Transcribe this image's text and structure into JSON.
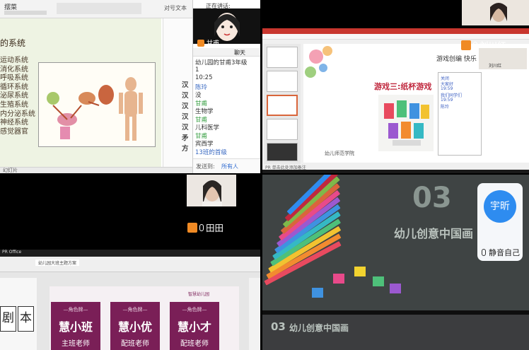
{
  "tile1": {
    "menu_label": "摆菜",
    "ribbon_right": "对号文本",
    "ribbon_far": "文本",
    "slide_title": "的系统",
    "slide_lines": [
      "运动系统",
      "消化系统",
      "呼吸系统",
      "循环系统",
      "泌尿系统",
      "生殖系统",
      "内分泌系统",
      "神经系统",
      "感觉器官"
    ],
    "side_items": [
      "汉",
      "汉",
      "汉",
      "汉",
      "汉",
      "矛",
      "方"
    ],
    "status_left": "幻灯片",
    "chat": {
      "status": "正在讲话:",
      "user_tag": "甘甫",
      "panel_title": "聊天",
      "messages": [
        {
          "text": "幼儿园的甘甫3年级",
          "cls": ""
        },
        {
          "text": "1",
          "cls": ""
        },
        {
          "text": "10:25",
          "cls": ""
        },
        {
          "text": "陈玲",
          "cls": "blue"
        },
        {
          "text": "没",
          "cls": ""
        },
        {
          "text": "甘甫",
          "cls": "green"
        },
        {
          "text": "生物学",
          "cls": ""
        },
        {
          "text": "甘甫",
          "cls": "green"
        },
        {
          "text": "儿科医学",
          "cls": ""
        },
        {
          "text": "甘甫",
          "cls": "green"
        },
        {
          "text": "宾西学",
          "cls": ""
        },
        {
          "text": "13班的首级",
          "cls": "blue"
        }
      ],
      "send_to_label": "发送到:",
      "send_to_value": "所有人"
    }
  },
  "tile2": {
    "slide_header": "游戏创编   快乐",
    "slide_title": "游戏三:纸杯游戏",
    "slide_footer": "幼儿师范学院",
    "name_tag": "刘川红",
    "small_tag": "刘川红",
    "chat_lines": [
      "关闭",
      "大家好",
      "19:59",
      "我们同学们",
      "19:59",
      "陈玲"
    ],
    "status_bar": "PR  单击此处添加备注"
  },
  "tile3": {
    "name_tag": "田田"
  },
  "tile4": {
    "top_title": "PR Office",
    "tab_label": "幼儿园大班主题方案",
    "cards": [
      {
        "role": "—角色牌—",
        "name": "慧小班",
        "sub": "主班老师"
      },
      {
        "role": "—角色牌—",
        "name": "慧小优",
        "sub": "配班老师"
      },
      {
        "role": "—角色牌—",
        "name": "慧小才",
        "sub": "配班老师"
      }
    ],
    "big_chars": [
      "剧",
      "本"
    ],
    "logo_text": "智慧幼儿园"
  },
  "tile5": {
    "number": "03",
    "heading": "幼儿创意中国画",
    "footer_number": "03",
    "footer_heading": "幼儿创意中国画",
    "self_button": {
      "avatar_text": "宇昕",
      "label": "静音自己"
    }
  },
  "colors": {
    "accent_orange": "#f08a24",
    "accent_blue": "#2e8cf0",
    "card_purple": "#7a1f57",
    "chalkboard": "#3f4444",
    "cup_title_red": "#c0283e"
  }
}
